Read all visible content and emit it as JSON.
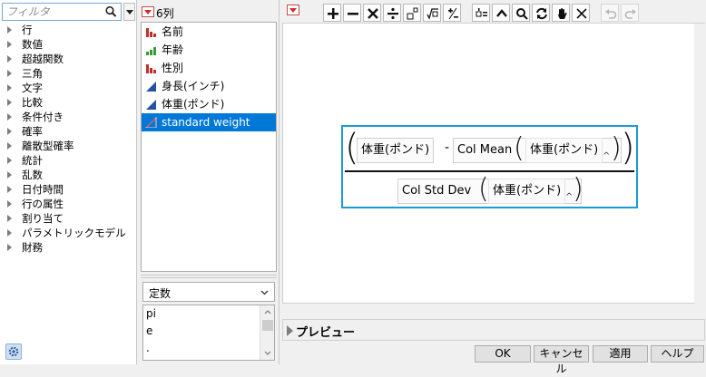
{
  "filter": {
    "placeholder": "フィルタ"
  },
  "categories": [
    "行",
    "数値",
    "超越関数",
    "三角",
    "文字",
    "比較",
    "条件付き",
    "確率",
    "離散型確率",
    "統計",
    "乱数",
    "日付時間",
    "行の属性",
    "割り当て",
    "パラメトリックモデル",
    "財務"
  ],
  "columns": {
    "count_label": "6列",
    "items": [
      {
        "label": "名前",
        "icon": "nominal-bar-icon"
      },
      {
        "label": "年齢",
        "icon": "ordinal-bar-icon"
      },
      {
        "label": "性別",
        "icon": "nominal-bar-icon"
      },
      {
        "label": "身長(インチ)",
        "icon": "continuous-triangle-icon"
      },
      {
        "label": "体重(ポンド)",
        "icon": "continuous-triangle-icon"
      },
      {
        "label": "standard weight",
        "icon": "formula-triangle-icon"
      }
    ]
  },
  "constants": {
    "selected": "定数",
    "items": [
      "pi",
      "e",
      "."
    ]
  },
  "formula": {
    "numerator": {
      "term1": "体重(ポンド)",
      "minus": "-",
      "func": "Col Mean",
      "arg": "体重(ポンド)"
    },
    "denominator": {
      "func": "Col Std Dev",
      "arg": "体重(ポンド)"
    }
  },
  "preview": {
    "label": "プレビュー"
  },
  "buttons": {
    "ok": "OK",
    "cancel": "キャンセル",
    "apply": "適用",
    "help": "ヘルプ"
  },
  "colors": {
    "accent": "#1a9bd7",
    "selection": "#0078d7",
    "nominal": "#c0302a",
    "continuous": "#2451a6"
  }
}
